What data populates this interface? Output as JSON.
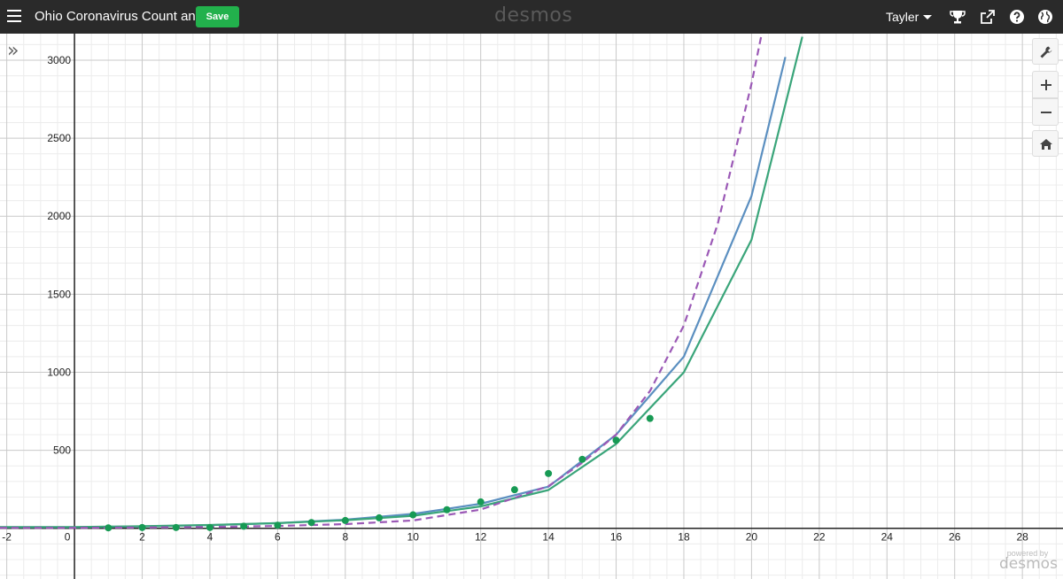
{
  "header": {
    "title": "Ohio Coronavirus Count an...",
    "save_label": "Save",
    "brand": "desmos",
    "user_name": "Tayler"
  },
  "powered_by": {
    "line1": "powered by",
    "line2": "desmos"
  },
  "colors": {
    "topbar": "#2a2a2a",
    "save": "#22b14c",
    "points": "#179a54",
    "curve_blue": "#5b8fc0",
    "curve_green": "#3aa57a",
    "curve_purple_dashed": "#9b59b6"
  },
  "icons": [
    "menu-icon",
    "trophy-icon",
    "share-icon",
    "help-icon",
    "globe-icon",
    "wrench-icon",
    "plus-icon",
    "minus-icon",
    "home-icon",
    "expand-icon"
  ],
  "chart_data": {
    "type": "scatter",
    "xlim": [
      -2.2,
      29.2
    ],
    "ylim": [
      -325,
      3170
    ],
    "x_tick_labels": [
      "-2",
      "0",
      "2",
      "4",
      "6",
      "8",
      "10",
      "12",
      "14",
      "16",
      "18",
      "20",
      "22",
      "24",
      "26",
      "28"
    ],
    "y_tick_labels": [
      "500",
      "1000",
      "1500",
      "2000",
      "2500",
      "3000"
    ],
    "grid": true,
    "series": [
      {
        "kind": "points",
        "color": "#179a54",
        "x": [
          1,
          2,
          3,
          4,
          5,
          6,
          7,
          8,
          9,
          10,
          11,
          12,
          13,
          14,
          15,
          16,
          17
        ],
        "y": [
          3,
          5,
          5,
          5,
          13,
          20,
          37,
          50,
          67,
          86,
          119,
          169,
          247,
          351,
          442,
          564,
          704
        ]
      },
      {
        "kind": "curve",
        "color": "#5b8fc0",
        "dashed": false,
        "x": [
          0,
          2,
          4,
          6,
          8,
          10,
          12,
          14,
          16,
          18,
          20,
          21
        ],
        "y": [
          7,
          12,
          20,
          33,
          55,
          92,
          157,
          267,
          600,
          1100,
          2130,
          3020
        ]
      },
      {
        "kind": "curve",
        "color": "#3aa57a",
        "dashed": false,
        "x": [
          0,
          2,
          4,
          6,
          8,
          10,
          12,
          14,
          16,
          18,
          20,
          21.5
        ],
        "y": [
          8,
          13,
          21,
          33,
          52,
          80,
          140,
          245,
          540,
          1000,
          1850,
          3150
        ]
      },
      {
        "kind": "curve",
        "color": "#9b59b6",
        "dashed": true,
        "x": [
          0,
          2,
          4,
          6,
          8,
          10,
          12,
          14,
          15,
          16,
          17,
          18,
          19,
          20,
          20.3
        ],
        "y": [
          3,
          5,
          8,
          15,
          27,
          50,
          120,
          270,
          420,
          600,
          880,
          1300,
          1950,
          2850,
          3170
        ]
      }
    ]
  }
}
